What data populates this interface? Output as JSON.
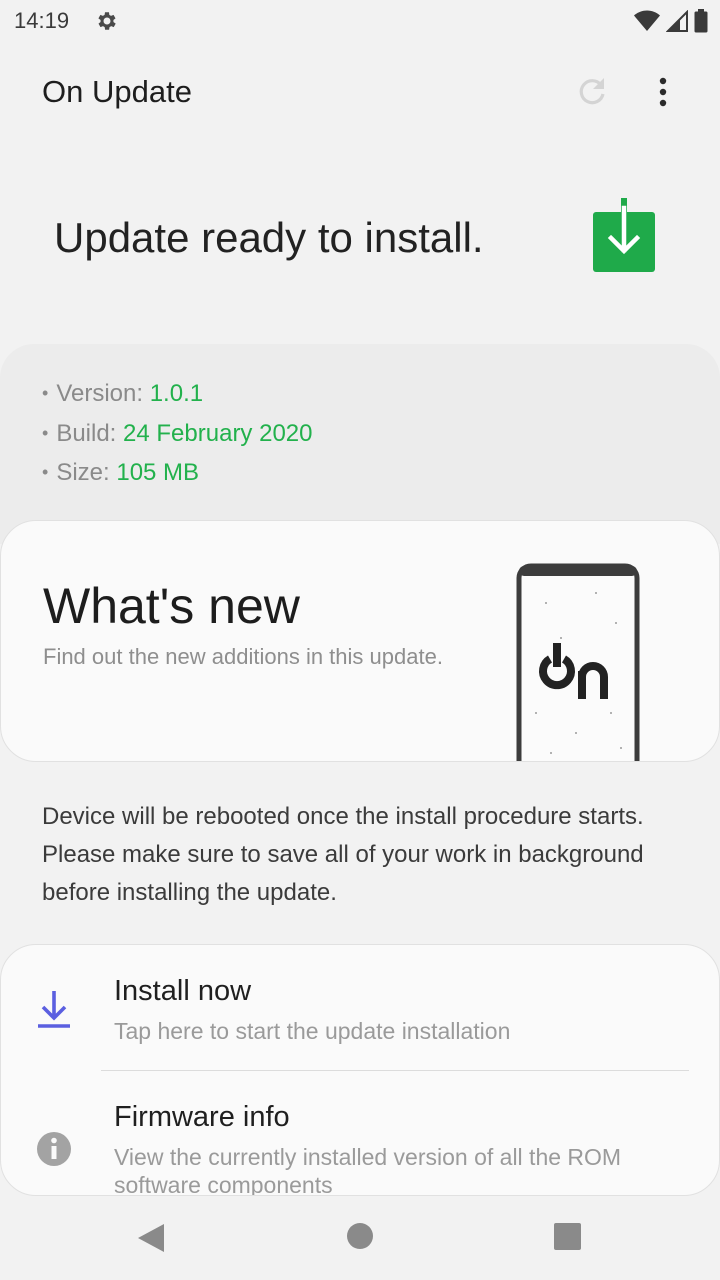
{
  "status_bar": {
    "time": "14:19",
    "icons": [
      "settings-gear-icon",
      "wifi-icon",
      "signal-icon",
      "battery-icon"
    ]
  },
  "app_bar": {
    "title": "On Update",
    "icons": [
      "refresh-icon",
      "more-vert-icon"
    ]
  },
  "hero": {
    "title": "Update ready to install.",
    "icon": "download-ready-icon",
    "icon_color": "#1faa4a"
  },
  "info": {
    "version_label": "Version:",
    "version_value": "1.0.1",
    "build_label": "Build:",
    "build_value": "24 February 2020",
    "size_label": "Size:",
    "size_value": "105 MB",
    "value_color": "#22b14c"
  },
  "whats_new": {
    "title": "What's new",
    "subtitle": "Find out the new additions in this update.",
    "illustration": "phone-on-logo"
  },
  "note": "Device will be rebooted once the install procedure starts. Please make sure to save all of your work in background before installing the update.",
  "actions": [
    {
      "title": "Install now",
      "subtitle": "Tap here to start the update installation",
      "icon": "download-icon",
      "icon_color": "#5b5fe0"
    },
    {
      "title": "Firmware info",
      "subtitle": "View the currently installed version of all the ROM software components",
      "icon": "info-icon"
    }
  ],
  "nav_bar": {
    "icons": [
      "back-icon",
      "home-icon",
      "recents-icon"
    ]
  }
}
